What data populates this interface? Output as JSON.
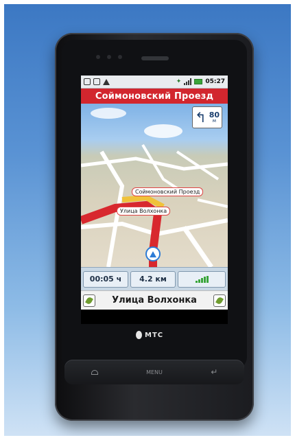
{
  "status_bar": {
    "time": "05:27",
    "icons": [
      "sim-icon",
      "sd-card-icon",
      "warning-icon",
      "satellite-icon",
      "signal-icon",
      "battery-icon"
    ]
  },
  "street_header": "Соймоновский Проезд",
  "turn": {
    "direction": "turn-left-icon",
    "distance": "80",
    "unit": "м"
  },
  "map_labels": {
    "street_1": "Соймоновский Проезд",
    "street_2": "Улица Волхонка"
  },
  "info": {
    "time_left": "00:05 ч",
    "distance_left": "4.2 км"
  },
  "current_street": "Улица Волхонка",
  "brand": "МТС",
  "hardware_buttons": {
    "home": "home-icon",
    "menu": "MENU",
    "back": "back-icon"
  },
  "colors": {
    "header_red": "#d2262e",
    "route_red": "#d8282e",
    "nav_blue": "#2c7bd6"
  }
}
